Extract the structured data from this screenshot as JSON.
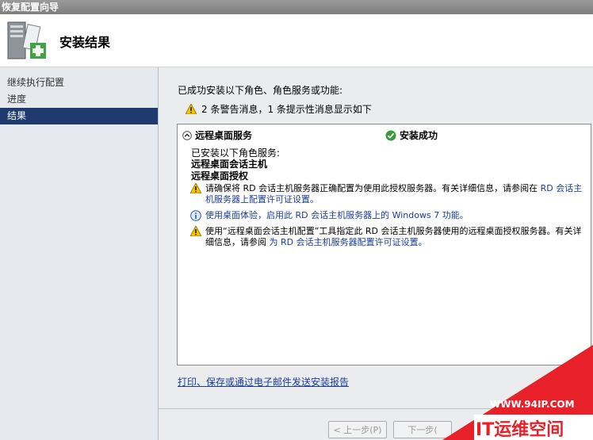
{
  "window": {
    "title": "恢复配置向导"
  },
  "header": {
    "title": "安装结果",
    "icon": "server-install-icon"
  },
  "sidebar": {
    "items": [
      {
        "label": "继续执行配置",
        "active": false
      },
      {
        "label": "进度",
        "active": false
      },
      {
        "label": "结果",
        "active": true
      }
    ]
  },
  "main": {
    "summary": "已成功安装以下角色、角色服务或功能:",
    "warning_summary": "2 条警告消息，1 条提示性消息显示如下",
    "result": {
      "role_name": "远程桌面服务",
      "status": "安装成功",
      "installed_label": "已安装以下角色服务:",
      "roles": [
        "远程桌面会话主机",
        "远程桌面授权"
      ],
      "messages": [
        {
          "type": "warning",
          "text": "请确保将 RD 会话主机服务器正确配置为使用此授权服务器。有关详细信息，请参阅在",
          "link": "RD 会话主机服务器上配置许可证设置。"
        },
        {
          "type": "info",
          "link": "使用桌面体验，启用此 RD 会话主机服务器上的 Windows 7 功能。"
        },
        {
          "type": "warning",
          "text": "使用“远程桌面会话主机配置”工具指定此 RD 会话主机服务器使用的远程桌面授权服务器。有关详细信息，请参阅",
          "link": "为 RD 会话主机服务器配置许可证设置。"
        }
      ]
    },
    "report_link": "打印、保存或通过电子邮件发送安装报告"
  },
  "buttons": {
    "prev": "< 上一步(P)",
    "next": "下一步("
  },
  "watermark": {
    "url": "WWW.94IP.COM",
    "brand": "IT运维空间"
  },
  "colors": {
    "sidebar_active": "#1e3a6e",
    "link": "#1a3c9c",
    "watermark": "#e8202a"
  }
}
